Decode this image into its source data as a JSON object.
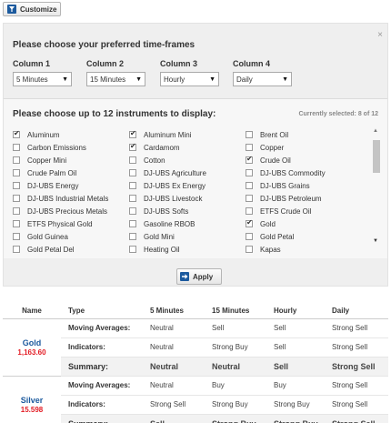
{
  "toolbar": {
    "customize_label": "Customize"
  },
  "timeframes": {
    "heading": "Please choose your preferred time-frames",
    "columns": [
      {
        "label": "Column 1",
        "value": "5 Minutes"
      },
      {
        "label": "Column 2",
        "value": "15 Minutes"
      },
      {
        "label": "Column 3",
        "value": "Hourly"
      },
      {
        "label": "Column 4",
        "value": "Daily"
      }
    ]
  },
  "instruments": {
    "heading": "Please choose up to 12 instruments to display:",
    "selected_text": "Currently selected: 8 of 12",
    "items": [
      {
        "label": "Aluminum",
        "checked": true
      },
      {
        "label": "Aluminum Mini",
        "checked": true
      },
      {
        "label": "Brent Oil",
        "checked": false
      },
      {
        "label": "Carbon Emissions",
        "checked": false
      },
      {
        "label": "Cardamom",
        "checked": true
      },
      {
        "label": "Copper",
        "checked": false
      },
      {
        "label": "Copper Mini",
        "checked": false
      },
      {
        "label": "Cotton",
        "checked": false
      },
      {
        "label": "Crude Oil",
        "checked": true
      },
      {
        "label": "Crude Palm Oil",
        "checked": false
      },
      {
        "label": "DJ-UBS Agriculture",
        "checked": false
      },
      {
        "label": "DJ-UBS Commodity",
        "checked": false
      },
      {
        "label": "DJ-UBS Energy",
        "checked": false
      },
      {
        "label": "DJ-UBS Ex Energy",
        "checked": false
      },
      {
        "label": "DJ-UBS Grains",
        "checked": false
      },
      {
        "label": "DJ-UBS Industrial Metals",
        "checked": false
      },
      {
        "label": "DJ-UBS Livestock",
        "checked": false
      },
      {
        "label": "DJ-UBS Petroleum",
        "checked": false
      },
      {
        "label": "DJ-UBS Precious Metals",
        "checked": false
      },
      {
        "label": "DJ-UBS Softs",
        "checked": false
      },
      {
        "label": "ETFS Crude Oil",
        "checked": false
      },
      {
        "label": "ETFS Physical Gold",
        "checked": false
      },
      {
        "label": "Gasoline RBOB",
        "checked": false
      },
      {
        "label": "Gold",
        "checked": true
      },
      {
        "label": "Gold Guinea",
        "checked": false
      },
      {
        "label": "Gold Mini",
        "checked": false
      },
      {
        "label": "Gold Petal",
        "checked": false
      },
      {
        "label": "Gold Petal Del",
        "checked": false
      },
      {
        "label": "Heating Oil",
        "checked": false
      },
      {
        "label": "Kapas",
        "checked": false
      }
    ]
  },
  "apply_label": "Apply",
  "table": {
    "headers": [
      "Name",
      "Type",
      "5 Minutes",
      "15 Minutes",
      "Hourly",
      "Daily"
    ],
    "rows": [
      {
        "name": "Gold",
        "price": "1,163.60",
        "lines": [
          {
            "type": "Moving Averages:",
            "values": [
              "Neutral",
              "Sell",
              "Sell",
              "Strong Sell"
            ]
          },
          {
            "type": "Indicators:",
            "values": [
              "Neutral",
              "Strong Buy",
              "Sell",
              "Strong Sell"
            ]
          },
          {
            "type": "Summary:",
            "values": [
              "Neutral",
              "Neutral",
              "Sell",
              "Strong Sell"
            ],
            "classes": [
              "neutral",
              "neutral",
              "sell",
              "sell"
            ]
          }
        ]
      },
      {
        "name": "Silver",
        "price": "15.598",
        "lines": [
          {
            "type": "Moving Averages:",
            "values": [
              "Neutral",
              "Buy",
              "Buy",
              "Strong Sell"
            ]
          },
          {
            "type": "Indicators:",
            "values": [
              "Strong Sell",
              "Strong Buy",
              "Strong Buy",
              "Strong Sell"
            ]
          },
          {
            "type": "Summary:",
            "values": [
              "Sell",
              "Strong Buy",
              "Strong Buy",
              "Strong Sell"
            ],
            "classes": [
              "sell",
              "buy",
              "buy",
              "sell"
            ]
          }
        ]
      }
    ]
  },
  "colors": {
    "sell": "#e31b23",
    "buy": "#1f9b2e",
    "link": "#1c5a9e",
    "neutral": "#888888"
  },
  "icons": [
    "funnel-icon",
    "close-icon",
    "dropdown-arrow-icon",
    "checkmark-icon",
    "scroll-up-icon",
    "scroll-down-icon",
    "arrow-right-icon"
  ]
}
